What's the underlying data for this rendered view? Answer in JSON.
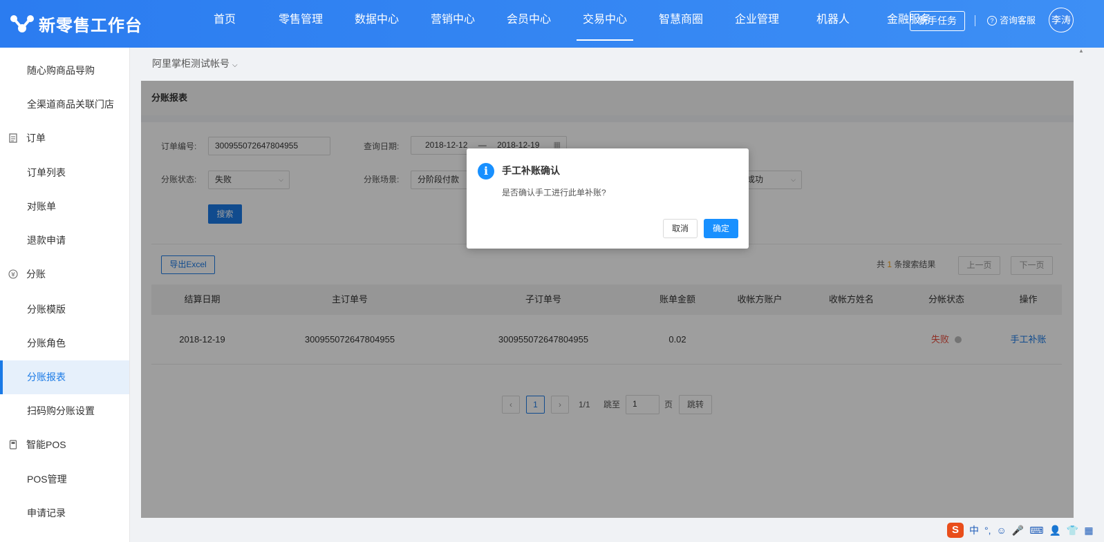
{
  "header": {
    "logo_text": "新零售工作台",
    "nav": [
      "首页",
      "零售管理",
      "数据中心",
      "营销中心",
      "会员中心",
      "交易中心",
      "智慧商圈",
      "企业管理",
      "机器人",
      "金融服务"
    ],
    "active_nav_index": 5,
    "newbie_label": "新手任务",
    "support_label": "咨询客服",
    "avatar_label": "李涛",
    "brand_color": "#2b7cf0"
  },
  "sidebar": {
    "items": [
      {
        "label": "随心购商品导购",
        "type": "item"
      },
      {
        "label": "全渠道商品关联门店",
        "type": "item"
      },
      {
        "label": "订单",
        "type": "group",
        "icon": "document-icon"
      },
      {
        "label": "订单列表",
        "type": "item"
      },
      {
        "label": "对账单",
        "type": "item"
      },
      {
        "label": "退款申请",
        "type": "item"
      },
      {
        "label": "分账",
        "type": "group",
        "icon": "yuan-icon"
      },
      {
        "label": "分账模版",
        "type": "item"
      },
      {
        "label": "分账角色",
        "type": "item"
      },
      {
        "label": "分账报表",
        "type": "item",
        "active": true
      },
      {
        "label": "扫码购分账设置",
        "type": "item"
      },
      {
        "label": "智能POS",
        "type": "group",
        "icon": "pos-icon"
      },
      {
        "label": "POS管理",
        "type": "item"
      },
      {
        "label": "申请记录",
        "type": "item"
      }
    ]
  },
  "main": {
    "account_label": "阿里掌柜测试帐号",
    "panel_title": "分账报表",
    "filters": {
      "order_no_label": "订单编号:",
      "order_no_value": "300955072647804955",
      "date_label": "查询日期:",
      "date_start": "2018-12-12",
      "date_sep": "—",
      "date_end": "2018-12-19",
      "status_label": "分账状态:",
      "status_value": "失败",
      "scene_label": "分账场景:",
      "scene_value": "分阶段付款",
      "third_select_value": "成功",
      "search_label": "搜索"
    },
    "export_label": "导出Excel",
    "result_prefix": "共",
    "result_count": "1",
    "result_suffix": "条搜索结果",
    "prev_label": "上一页",
    "next_label": "下一页",
    "table": {
      "columns": [
        "结算日期",
        "主订单号",
        "子订单号",
        "账单金额",
        "收帐方账户",
        "收帐方姓名",
        "分帐状态",
        "操作"
      ],
      "rows": [
        {
          "date": "2018-12-19",
          "main_order": "300955072647804955",
          "sub_order": "300955072647804955",
          "amount": "0.02",
          "payee_account": "",
          "payee_name": "",
          "status": "失败",
          "action": "手工补账"
        }
      ]
    },
    "pager": {
      "current_page": "1",
      "page_info": "1/1",
      "jump_label": "跳至",
      "jump_value": "1",
      "page_unit": "页",
      "go_label": "跳转",
      "prev_arrow": "‹",
      "next_arrow": "›"
    }
  },
  "dialog": {
    "title": "手工补账确认",
    "message": "是否确认手工进行此单补账?",
    "cancel_label": "取消",
    "ok_label": "确定",
    "icon": "info-icon"
  },
  "tray": {
    "ime_logo": "S",
    "items": [
      "中",
      "°,",
      "☺",
      "🎤",
      "⌨",
      "👤",
      "👕",
      "▦"
    ]
  }
}
